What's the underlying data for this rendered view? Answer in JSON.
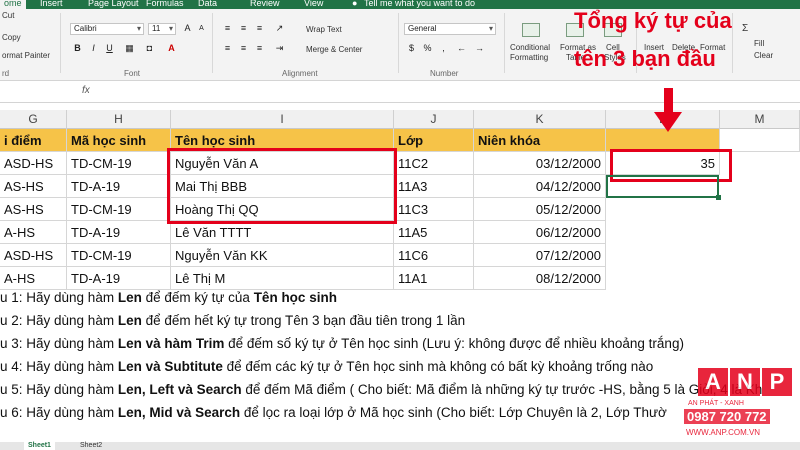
{
  "ribbon": {
    "tabs": [
      "ome",
      "Insert",
      "Page Layout",
      "Formulas",
      "Data",
      "Review",
      "View"
    ],
    "tell_me": "Tell me what you want to do",
    "clipboard": {
      "cut": "Cut",
      "copy": "Copy",
      "format_painter": "ormat Painter"
    },
    "font": {
      "name": "Calibri",
      "size": "11"
    },
    "alignment": {
      "wrap_text": "Wrap Text",
      "merge_center": "Merge & Center"
    },
    "number": {
      "format": "General"
    },
    "styles": {
      "conditional": "Conditional",
      "formatting": "Formatting",
      "format_as": "Format as",
      "table": "Table",
      "cell": "Cell",
      "styles": "Styles"
    },
    "cells": {
      "insert": "Insert",
      "delete": "Delete",
      "format": "Format"
    },
    "editing": {
      "sum": "Σ",
      "fill": "Fill",
      "clear": "Clear"
    },
    "group_labels": {
      "clipboard": "rd",
      "font": "Font",
      "alignment": "Alignment",
      "number": "Number"
    }
  },
  "columns": [
    "G",
    "H",
    "I",
    "J",
    "K",
    "L",
    "M"
  ],
  "table": {
    "headers": [
      "i điểm",
      "Mã học sinh",
      "Tên học sinh",
      "Lớp",
      "Niên khóa"
    ],
    "rows": [
      [
        "ASD-HS",
        "TD-CM-19",
        "Nguyễn Văn A",
        "11C2",
        "03/12/2000"
      ],
      [
        "AS-HS",
        "TD-A-19",
        "Mai Thị BBB",
        "11A3",
        "04/12/2000"
      ],
      [
        "AS-HS",
        "TD-CM-19",
        "Hoàng Thị QQ",
        "11C3",
        "05/12/2000"
      ],
      [
        "A-HS",
        "TD-A-19",
        "Lê Văn TTTT",
        "11A5",
        "06/12/2000"
      ],
      [
        "ASD-HS",
        "TD-CM-19",
        "Nguyễn Văn KK",
        "11C6",
        "07/12/2000"
      ],
      [
        "A-HS",
        "TD-A-19",
        "Lê Thị M",
        "11A1",
        "08/12/2000"
      ]
    ]
  },
  "result": {
    "value": "35"
  },
  "questions": [
    {
      "prefix": "u 1: Hãy dùng hàm ",
      "b1": "Len",
      "mid": " để đếm ký tự của ",
      "b2": "Tên học sinh",
      "tail": ""
    },
    {
      "prefix": "u 2: Hãy dùng hàm ",
      "b1": "Len",
      "mid": " để đếm hết ký tự trong Tên 3 bạn đầu tiên  trong 1 lần",
      "b2": "",
      "tail": ""
    },
    {
      "prefix": "u 3: Hãy dùng hàm ",
      "b1": "Len và hàm Trim",
      "mid": " để đếm số ký tự ở Tên học sinh (Lưu ý: không được để nhiều khoảng trắng)",
      "b2": "",
      "tail": ""
    },
    {
      "prefix": "u 4: Hãy dùng hàm ",
      "b1": "Len và Subtitute",
      "mid": " để đếm các ký tự ở Tên học sinh mà không có bất kỳ khoảng trống nào",
      "b2": "",
      "tail": ""
    },
    {
      "prefix": "u 5: Hãy dùng hàm ",
      "b1": "Len, Left và Search",
      "mid": " để đếm Mã điểm ( Cho biết: Mã điểm là những ký tự trước -HS, bằng 5 là Giỏi, 4 là Kh",
      "b2": "",
      "tail": ""
    },
    {
      "prefix": "u 6: Hãy dùng hàm ",
      "b1": "Len, Mid và Search",
      "mid": " để lọc ra loại lớp ở Mã học sinh (Cho biết: Lớp Chuyên là 2, Lớp Thườ",
      "b2": "",
      "tail": ""
    }
  ],
  "annotation": {
    "line1": "Tổng ký tự của",
    "line2": "tên 3 bạn đầu"
  },
  "sheets": [
    "Sheet1",
    "Sheet2"
  ],
  "watermark": {
    "letters": [
      "A",
      "N",
      "P"
    ],
    "sub": "AN PHÁT - XANH",
    "phone": "0987 720 772",
    "url": "WWW.ANP.COM.VN"
  },
  "colors": {
    "excel_green": "#217346",
    "header_fill": "#f6c348",
    "annotation_red": "#e4001b"
  }
}
